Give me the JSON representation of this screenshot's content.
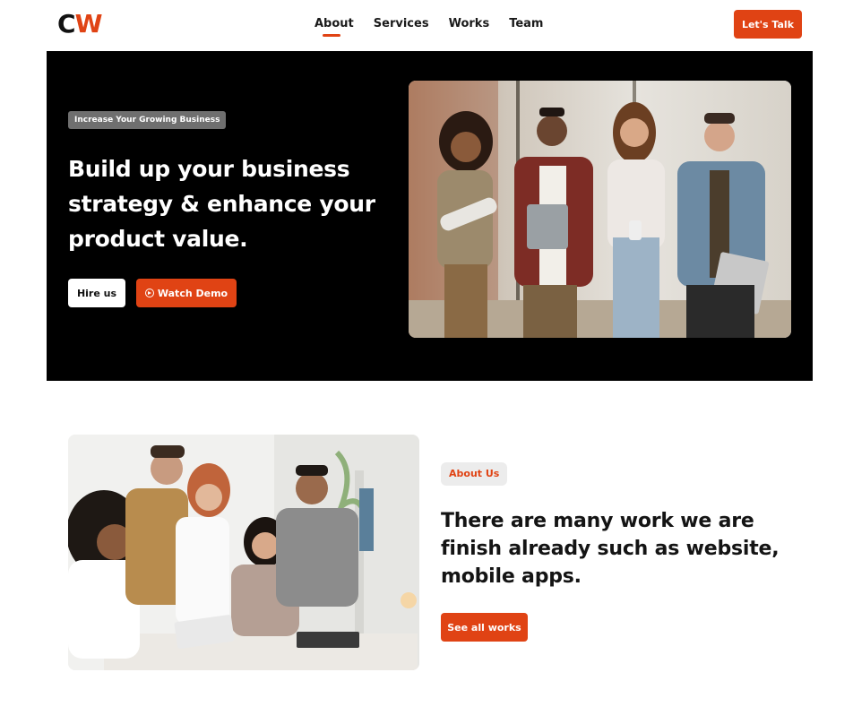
{
  "header": {
    "logo_c": "C",
    "logo_w": "W",
    "nav": [
      {
        "label": "About",
        "active": true
      },
      {
        "label": "Services",
        "active": false
      },
      {
        "label": "Works",
        "active": false
      },
      {
        "label": "Team",
        "active": false
      }
    ],
    "cta_label": "Let's Talk"
  },
  "hero": {
    "badge": "Increase Your Growing Business",
    "title": "Build up your business strategy & enhance your product value.",
    "hire_label": "Hire us",
    "demo_label": "Watch Demo",
    "demo_icon": "play-circle-icon",
    "photo": "team-of-four-standing-photo"
  },
  "about": {
    "photo": "team-meeting-at-table-photo",
    "badge": "About Us",
    "title": "There are many work we are finish already such as website, mobile apps.",
    "works_label": "See all works"
  },
  "colors": {
    "accent": "#e04314",
    "hero_bg": "#000000",
    "badge_grey": "#6f6f6f"
  }
}
